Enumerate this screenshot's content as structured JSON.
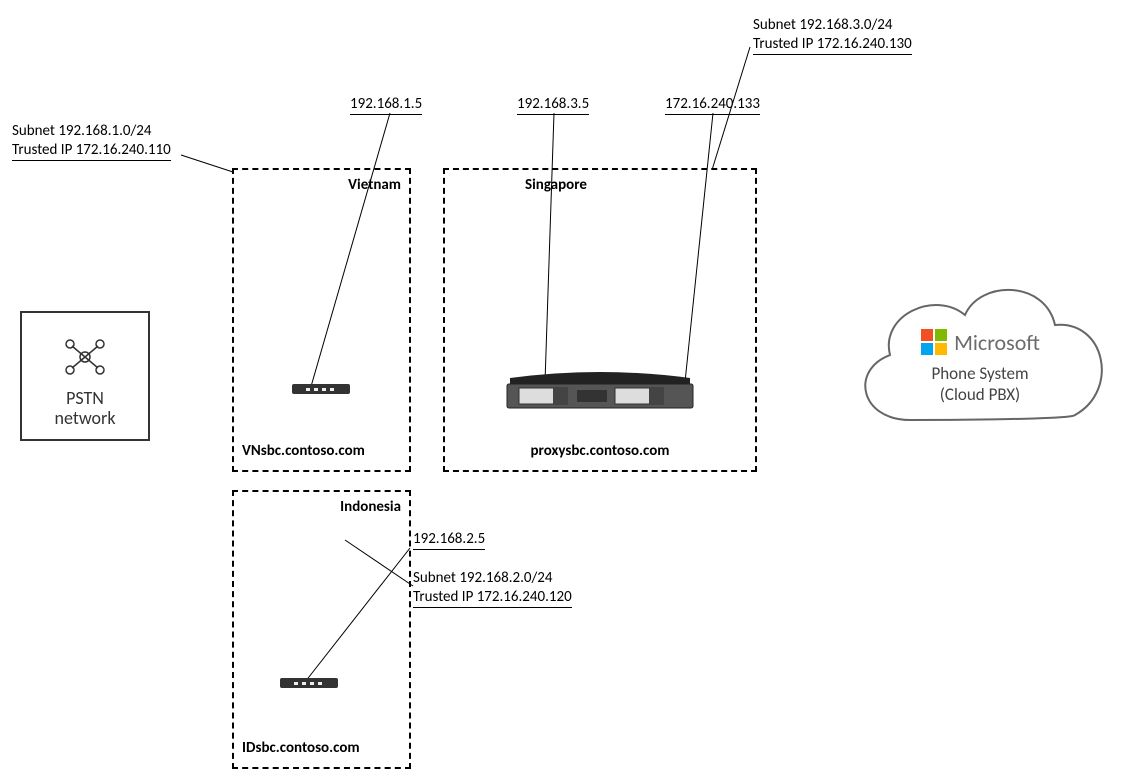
{
  "pstn": {
    "title": "PSTN\nnetwork"
  },
  "sites": {
    "vietnam": {
      "name": "Vietnam",
      "ip": "192.168.1.5",
      "subnet": "Subnet 192.168.1.0/24",
      "trusted": "Trusted IP 172.16.240.110",
      "domain": "VNsbc.contoso.com"
    },
    "singapore": {
      "name": "Singapore",
      "proxy_ip": "192.168.3.5",
      "external_ip": "172.16.240.133",
      "subnet": "Subnet 192.168.3.0/24",
      "trusted": "Trusted IP 172.16.240.130",
      "domain": "proxysbc.contoso.com"
    },
    "indonesia": {
      "name": "Indonesia",
      "ip": "192.168.2.5",
      "subnet": "Subnet 192.168.2.0/24",
      "trusted": "Trusted IP 172.16.240.120",
      "domain": "IDsbc.contoso.com"
    }
  },
  "cloud": {
    "brand": "Microsoft",
    "line1": "Phone System",
    "line2": "(Cloud PBX)"
  }
}
